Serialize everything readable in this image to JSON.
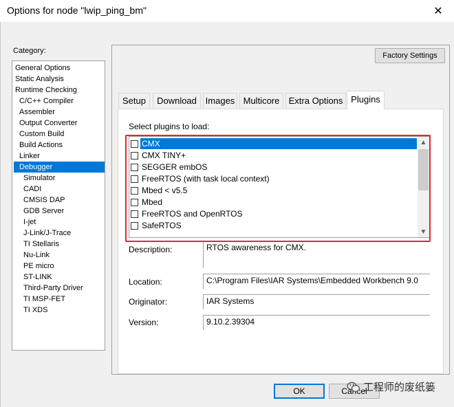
{
  "window": {
    "title": "Options for node \"lwip_ping_bm\"",
    "close_glyph": "✕"
  },
  "category": {
    "label": "Category:",
    "items": [
      "General Options",
      "Static Analysis",
      "Runtime Checking",
      "C/C++ Compiler",
      "Assembler",
      "Output Converter",
      "Custom Build",
      "Build Actions",
      "Linker",
      "Debugger",
      "Simulator",
      "CADI",
      "CMSIS DAP",
      "GDB Server",
      "I-jet",
      "J-Link/J-Trace",
      "TI Stellaris",
      "Nu-Link",
      "PE micro",
      "ST-LINK",
      "Third-Party Driver",
      "TI MSP-FET",
      "TI XDS"
    ],
    "selected": "Debugger"
  },
  "factory_button": "Factory Settings",
  "tabs": [
    "Setup",
    "Download",
    "Images",
    "Multicore",
    "Extra Options",
    "Plugins"
  ],
  "active_tab": "Plugins",
  "plugins": {
    "label": "Select plugins to load:",
    "items": [
      {
        "name": "CMX",
        "checked": false,
        "selected": true
      },
      {
        "name": "CMX TINY+",
        "checked": false
      },
      {
        "name": "SEGGER embOS",
        "checked": false
      },
      {
        "name": "FreeRTOS (with task local context)",
        "checked": false
      },
      {
        "name": "Mbed < v5.5",
        "checked": false
      },
      {
        "name": "Mbed",
        "checked": false
      },
      {
        "name": "FreeRTOS and OpenRTOS",
        "checked": false
      },
      {
        "name": "SafeRTOS",
        "checked": false
      }
    ]
  },
  "details": {
    "description_label": "Description:",
    "description_value": "RTOS awareness for CMX.",
    "location_label": "Location:",
    "location_value": "C:\\Program Files\\IAR Systems\\Embedded Workbench 9.0",
    "originator_label": "Originator:",
    "originator_value": "IAR Systems",
    "version_label": "Version:",
    "version_value": "9.10.2.39304"
  },
  "buttons": {
    "ok": "OK",
    "cancel": "Cancel"
  },
  "watermark": "工程师的废纸篓",
  "colors": {
    "selection": "#0078d7",
    "highlight_frame": "#e0292f"
  }
}
